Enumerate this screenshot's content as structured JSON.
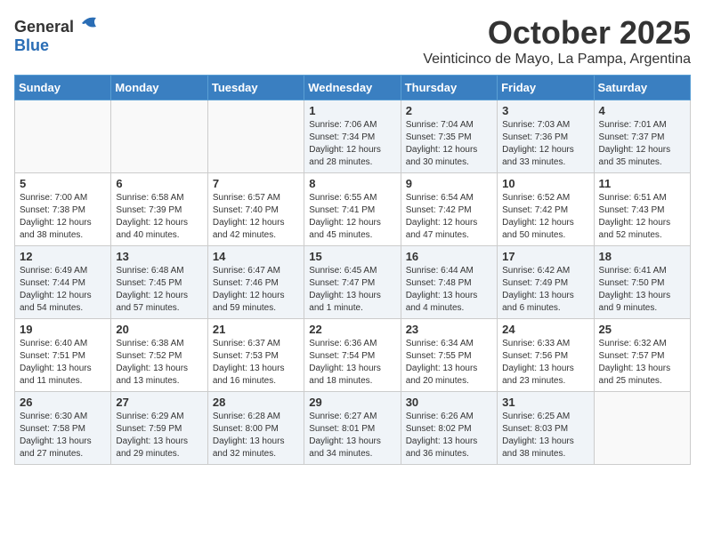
{
  "header": {
    "logo_general": "General",
    "logo_blue": "Blue",
    "month_title": "October 2025",
    "subtitle": "Veinticinco de Mayo, La Pampa, Argentina"
  },
  "weekdays": [
    "Sunday",
    "Monday",
    "Tuesday",
    "Wednesday",
    "Thursday",
    "Friday",
    "Saturday"
  ],
  "weeks": [
    [
      {
        "day": "",
        "info": ""
      },
      {
        "day": "",
        "info": ""
      },
      {
        "day": "",
        "info": ""
      },
      {
        "day": "1",
        "info": "Sunrise: 7:06 AM\nSunset: 7:34 PM\nDaylight: 12 hours\nand 28 minutes."
      },
      {
        "day": "2",
        "info": "Sunrise: 7:04 AM\nSunset: 7:35 PM\nDaylight: 12 hours\nand 30 minutes."
      },
      {
        "day": "3",
        "info": "Sunrise: 7:03 AM\nSunset: 7:36 PM\nDaylight: 12 hours\nand 33 minutes."
      },
      {
        "day": "4",
        "info": "Sunrise: 7:01 AM\nSunset: 7:37 PM\nDaylight: 12 hours\nand 35 minutes."
      }
    ],
    [
      {
        "day": "5",
        "info": "Sunrise: 7:00 AM\nSunset: 7:38 PM\nDaylight: 12 hours\nand 38 minutes."
      },
      {
        "day": "6",
        "info": "Sunrise: 6:58 AM\nSunset: 7:39 PM\nDaylight: 12 hours\nand 40 minutes."
      },
      {
        "day": "7",
        "info": "Sunrise: 6:57 AM\nSunset: 7:40 PM\nDaylight: 12 hours\nand 42 minutes."
      },
      {
        "day": "8",
        "info": "Sunrise: 6:55 AM\nSunset: 7:41 PM\nDaylight: 12 hours\nand 45 minutes."
      },
      {
        "day": "9",
        "info": "Sunrise: 6:54 AM\nSunset: 7:42 PM\nDaylight: 12 hours\nand 47 minutes."
      },
      {
        "day": "10",
        "info": "Sunrise: 6:52 AM\nSunset: 7:42 PM\nDaylight: 12 hours\nand 50 minutes."
      },
      {
        "day": "11",
        "info": "Sunrise: 6:51 AM\nSunset: 7:43 PM\nDaylight: 12 hours\nand 52 minutes."
      }
    ],
    [
      {
        "day": "12",
        "info": "Sunrise: 6:49 AM\nSunset: 7:44 PM\nDaylight: 12 hours\nand 54 minutes."
      },
      {
        "day": "13",
        "info": "Sunrise: 6:48 AM\nSunset: 7:45 PM\nDaylight: 12 hours\nand 57 minutes."
      },
      {
        "day": "14",
        "info": "Sunrise: 6:47 AM\nSunset: 7:46 PM\nDaylight: 12 hours\nand 59 minutes."
      },
      {
        "day": "15",
        "info": "Sunrise: 6:45 AM\nSunset: 7:47 PM\nDaylight: 13 hours\nand 1 minute."
      },
      {
        "day": "16",
        "info": "Sunrise: 6:44 AM\nSunset: 7:48 PM\nDaylight: 13 hours\nand 4 minutes."
      },
      {
        "day": "17",
        "info": "Sunrise: 6:42 AM\nSunset: 7:49 PM\nDaylight: 13 hours\nand 6 minutes."
      },
      {
        "day": "18",
        "info": "Sunrise: 6:41 AM\nSunset: 7:50 PM\nDaylight: 13 hours\nand 9 minutes."
      }
    ],
    [
      {
        "day": "19",
        "info": "Sunrise: 6:40 AM\nSunset: 7:51 PM\nDaylight: 13 hours\nand 11 minutes."
      },
      {
        "day": "20",
        "info": "Sunrise: 6:38 AM\nSunset: 7:52 PM\nDaylight: 13 hours\nand 13 minutes."
      },
      {
        "day": "21",
        "info": "Sunrise: 6:37 AM\nSunset: 7:53 PM\nDaylight: 13 hours\nand 16 minutes."
      },
      {
        "day": "22",
        "info": "Sunrise: 6:36 AM\nSunset: 7:54 PM\nDaylight: 13 hours\nand 18 minutes."
      },
      {
        "day": "23",
        "info": "Sunrise: 6:34 AM\nSunset: 7:55 PM\nDaylight: 13 hours\nand 20 minutes."
      },
      {
        "day": "24",
        "info": "Sunrise: 6:33 AM\nSunset: 7:56 PM\nDaylight: 13 hours\nand 23 minutes."
      },
      {
        "day": "25",
        "info": "Sunrise: 6:32 AM\nSunset: 7:57 PM\nDaylight: 13 hours\nand 25 minutes."
      }
    ],
    [
      {
        "day": "26",
        "info": "Sunrise: 6:30 AM\nSunset: 7:58 PM\nDaylight: 13 hours\nand 27 minutes."
      },
      {
        "day": "27",
        "info": "Sunrise: 6:29 AM\nSunset: 7:59 PM\nDaylight: 13 hours\nand 29 minutes."
      },
      {
        "day": "28",
        "info": "Sunrise: 6:28 AM\nSunset: 8:00 PM\nDaylight: 13 hours\nand 32 minutes."
      },
      {
        "day": "29",
        "info": "Sunrise: 6:27 AM\nSunset: 8:01 PM\nDaylight: 13 hours\nand 34 minutes."
      },
      {
        "day": "30",
        "info": "Sunrise: 6:26 AM\nSunset: 8:02 PM\nDaylight: 13 hours\nand 36 minutes."
      },
      {
        "day": "31",
        "info": "Sunrise: 6:25 AM\nSunset: 8:03 PM\nDaylight: 13 hours\nand 38 minutes."
      },
      {
        "day": "",
        "info": ""
      }
    ]
  ]
}
